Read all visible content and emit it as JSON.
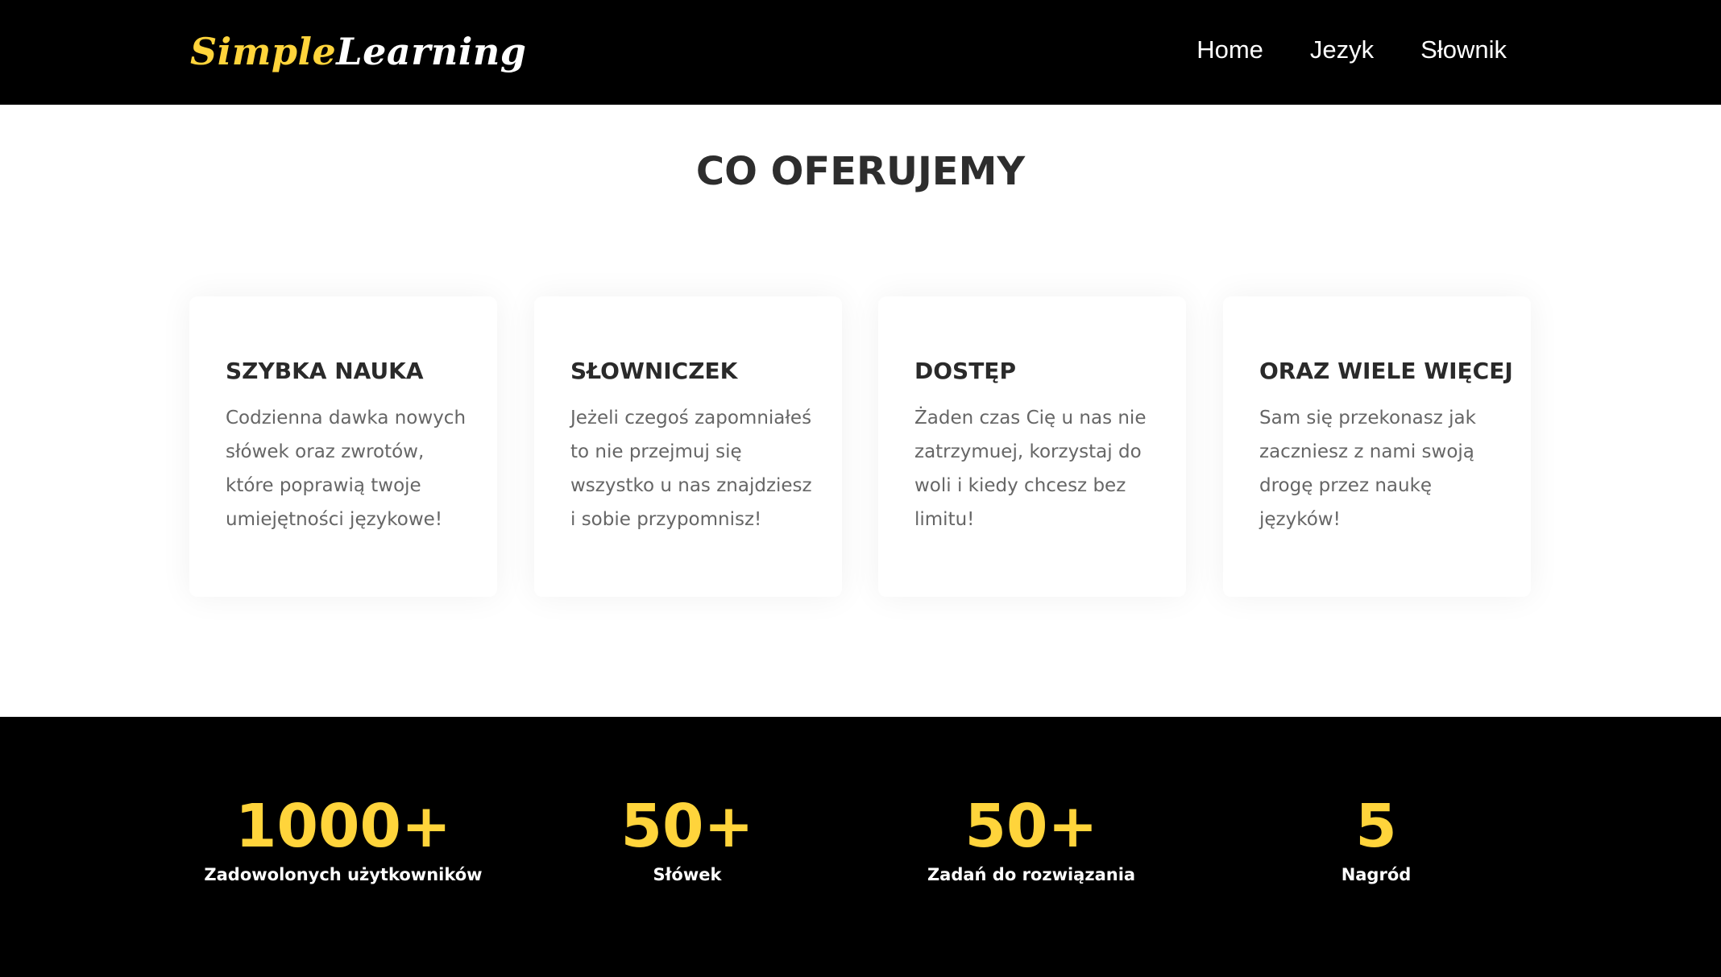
{
  "navbar": {
    "logo_part1": "Simple",
    "logo_part2": "Learning",
    "links": [
      {
        "label": "Home"
      },
      {
        "label": "Jezyk"
      },
      {
        "label": "Słownik"
      }
    ]
  },
  "offer": {
    "title": "CO OFERUJEMY",
    "cards": [
      {
        "title": "SZYBKA NAUKA",
        "text": "Codzienna dawka nowych słówek oraz zwrotów, które poprawią twoje umiejętności językowe!"
      },
      {
        "title": "SŁOWNICZEK",
        "text": "Jeżeli czegoś zapomniałeś to nie przejmuj się wszystko u nas znajdziesz i sobie przypomnisz!"
      },
      {
        "title": "DOSTĘP",
        "text": "Żaden czas Cię u nas nie zatrzymuej, korzystaj do woli i kiedy chcesz bez limitu!"
      },
      {
        "title": "ORAZ WIELE WIĘCEJ",
        "text": "Sam się przekonasz jak zaczniesz z nami swoją drogę przez naukę języków!"
      }
    ]
  },
  "stats": [
    {
      "value": "1000+",
      "label": "Zadowolonych użytkowników"
    },
    {
      "value": "50+",
      "label": "Słówek"
    },
    {
      "value": "50+",
      "label": "Zadań do rozwiązania"
    },
    {
      "value": "5",
      "label": "Nagród"
    }
  ],
  "colors": {
    "accent": "#ffd43b",
    "background_dark": "#000000",
    "background_light": "#ffffff"
  }
}
